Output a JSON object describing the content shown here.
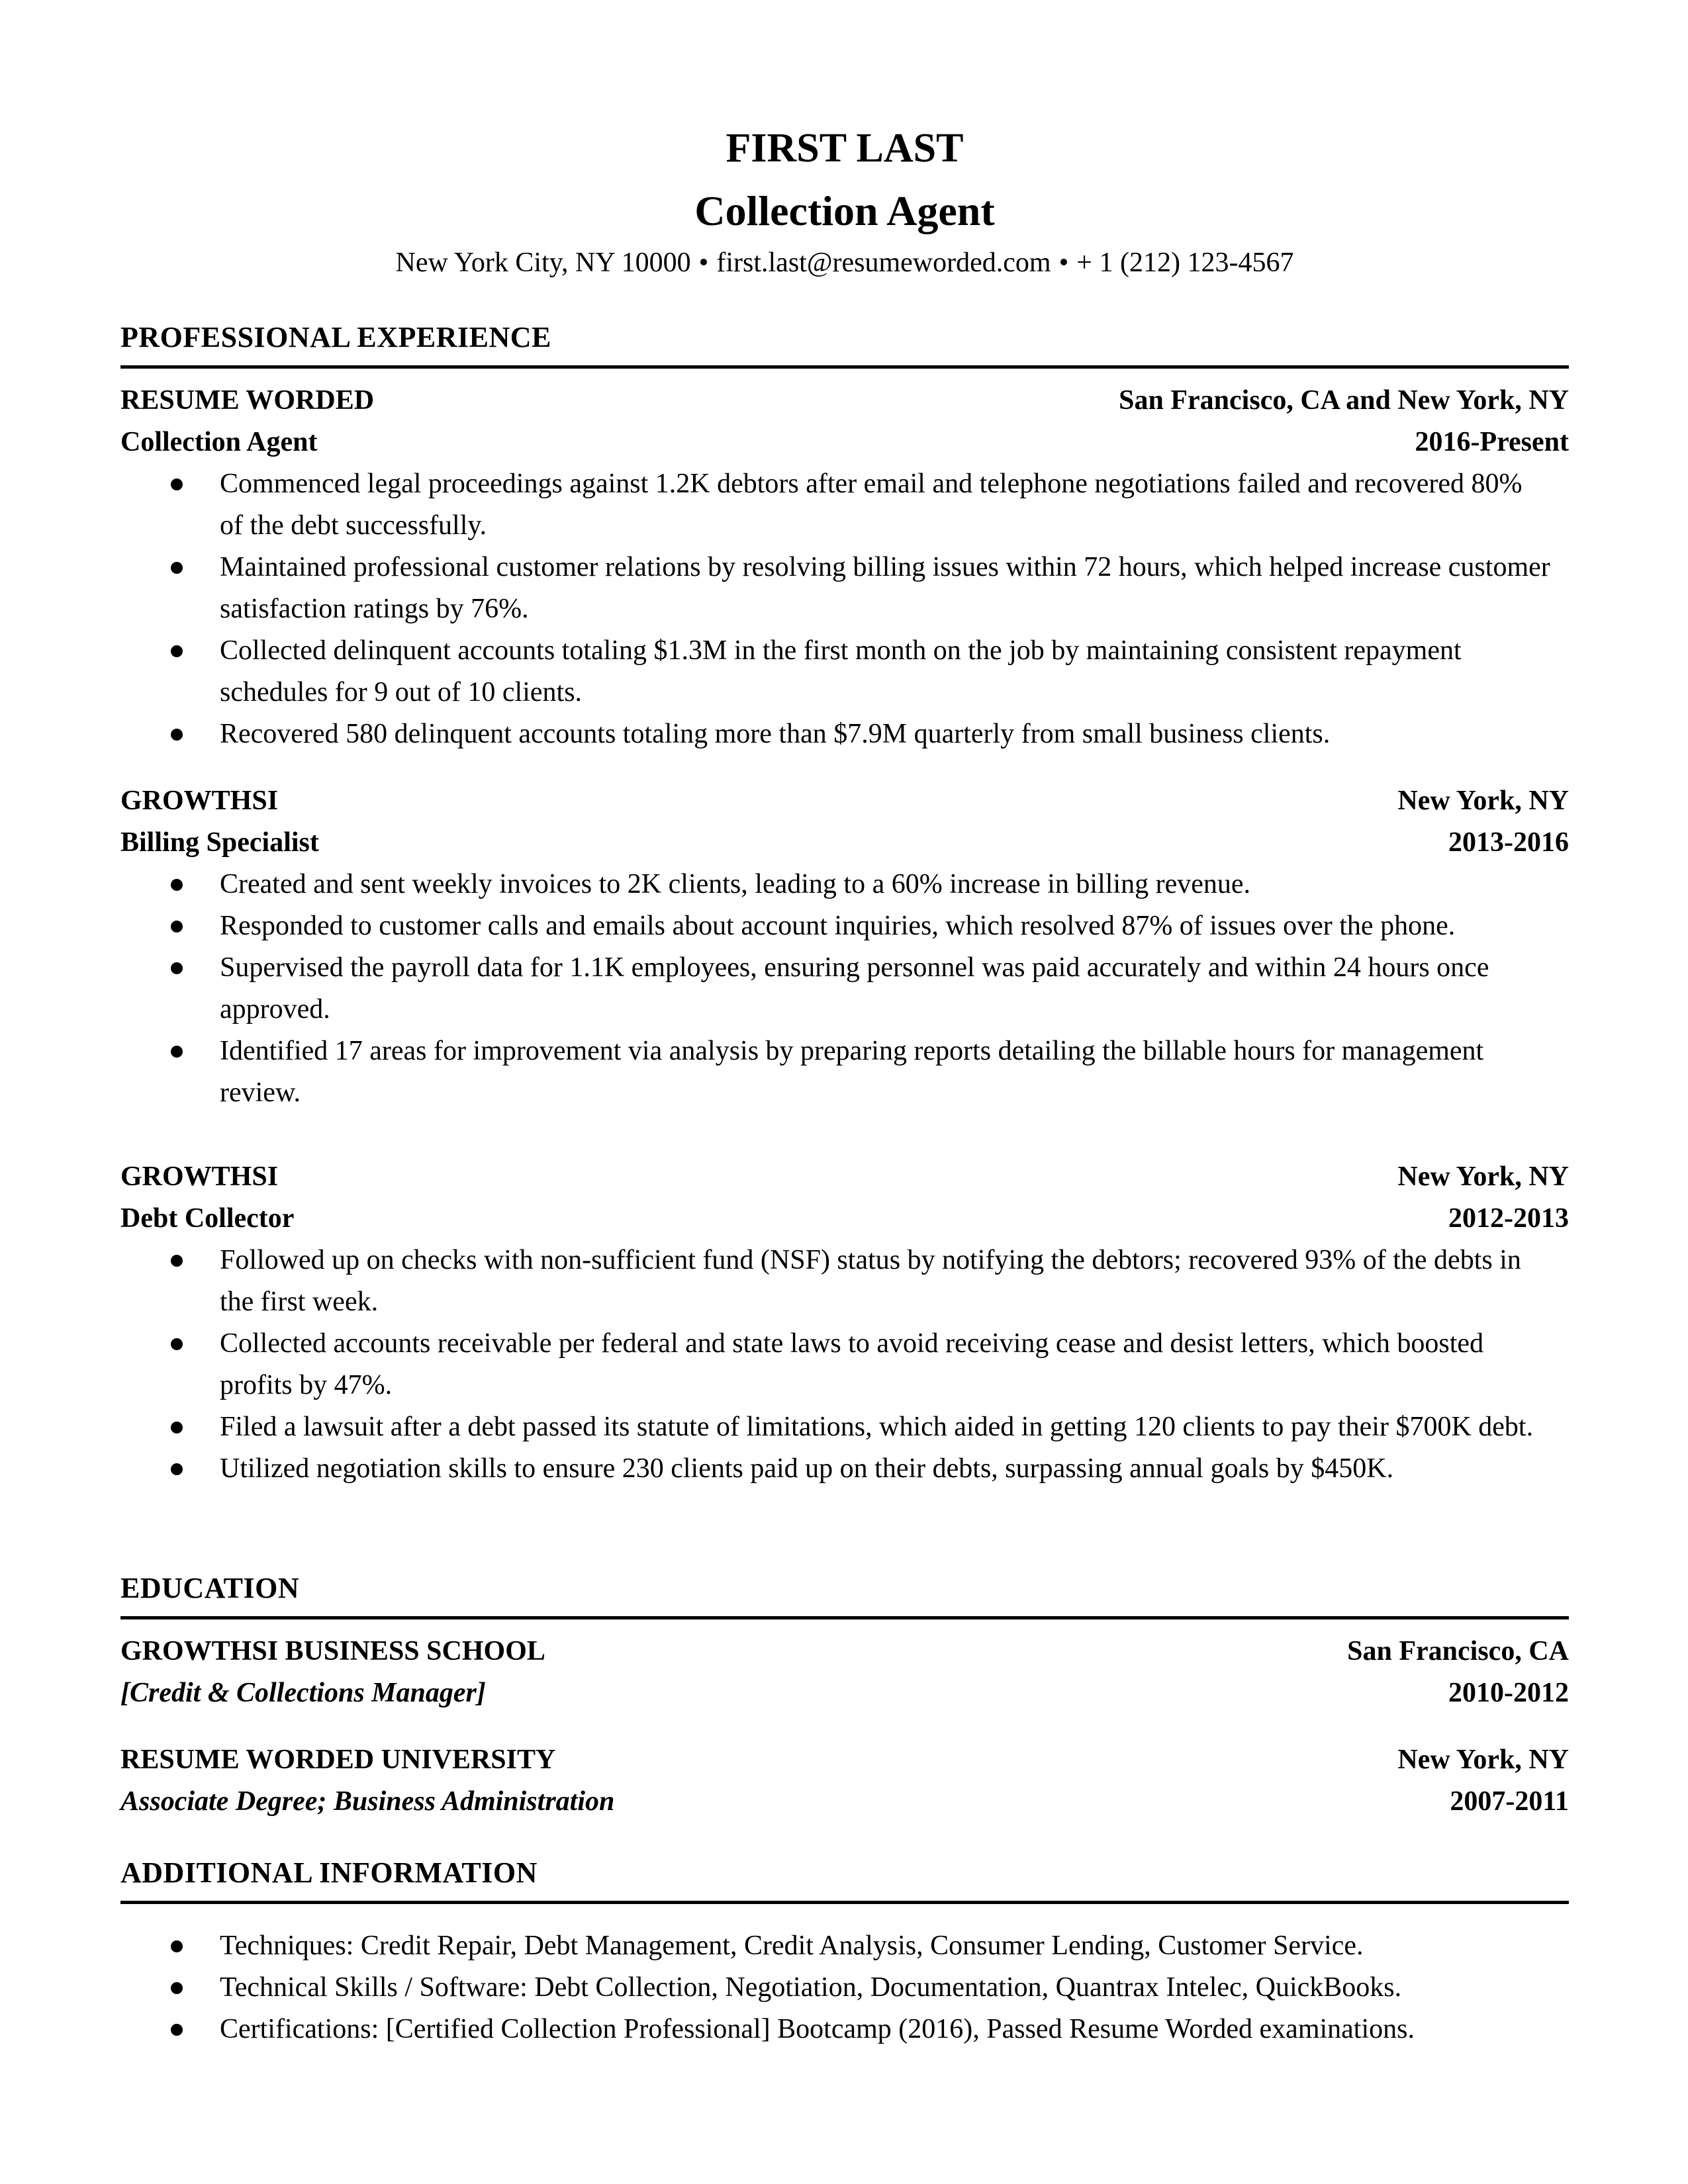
{
  "header": {
    "name": "FIRST LAST",
    "title": "Collection Agent",
    "contact": {
      "location": "New York City, NY 10000",
      "email": "first.last@resumeworded.com",
      "phone": "+ 1 (212) 123-4567",
      "separator": "•"
    }
  },
  "experience": {
    "heading": "PROFESSIONAL EXPERIENCE",
    "jobs": [
      {
        "company": "RESUME WORDED",
        "location": "San Francisco, CA and New York, NY",
        "role": "Collection Agent",
        "dates": "2016-Present",
        "bullets": [
          "Commenced legal proceedings against 1.2K debtors after email and telephone negotiations failed and recovered 80% of the debt successfully.",
          "Maintained professional customer relations by resolving billing issues within 72 hours, which helped increase customer satisfaction ratings by 76%.",
          "Collected delinquent accounts totaling $1.3M in the first month on the job by maintaining consistent repayment schedules for 9 out of 10 clients.",
          "Recovered 580 delinquent accounts totaling more than $7.9M quarterly from small business clients."
        ]
      },
      {
        "company": "GROWTHSI",
        "location": "New York, NY",
        "role": "Billing Specialist",
        "dates": "2013-2016",
        "bullets": [
          "Created and sent weekly invoices to 2K clients, leading to a 60% increase in billing revenue.",
          "Responded to customer calls and emails about account inquiries, which resolved 87% of issues over the phone.",
          "Supervised the payroll data for 1.1K employees, ensuring personnel was paid accurately and within 24 hours once approved.",
          "Identified 17 areas for improvement via analysis by preparing reports detailing the billable hours for management review."
        ]
      },
      {
        "company": "GROWTHSI",
        "location": "New York, NY",
        "role": "Debt Collector",
        "dates": "2012-2013",
        "bullets": [
          "Followed up on checks with non-sufficient fund (NSF) status by notifying the debtors; recovered 93% of the debts in the first week.",
          "Collected accounts receivable per federal and state laws to avoid receiving cease and desist letters, which boosted profits by 47%.",
          "Filed a lawsuit after a debt passed its statute of limitations, which aided in getting 120 clients to pay their $700K debt.",
          "Utilized negotiation skills to ensure 230 clients paid up on their debts, surpassing annual goals by $450K."
        ]
      }
    ]
  },
  "education": {
    "heading": "EDUCATION",
    "schools": [
      {
        "name": "GROWTHSI BUSINESS SCHOOL",
        "location": "San Francisco, CA",
        "degree": "[Credit & Collections Manager]",
        "dates": "2010-2012"
      },
      {
        "name": "RESUME WORDED UNIVERSITY",
        "location": "New York, NY",
        "degree": "Associate Degree; Business Administration",
        "dates": "2007-2011"
      }
    ]
  },
  "additional": {
    "heading": "ADDITIONAL INFORMATION",
    "items": [
      "Techniques: Credit Repair, Debt Management, Credit Analysis, Consumer Lending, Customer Service.",
      "Technical Skills / Software: Debt Collection, Negotiation, Documentation, Quantrax Intelec, QuickBooks.",
      "Certifications: [Certified Collection Professional] Bootcamp (2016), Passed Resume Worded examinations."
    ]
  }
}
